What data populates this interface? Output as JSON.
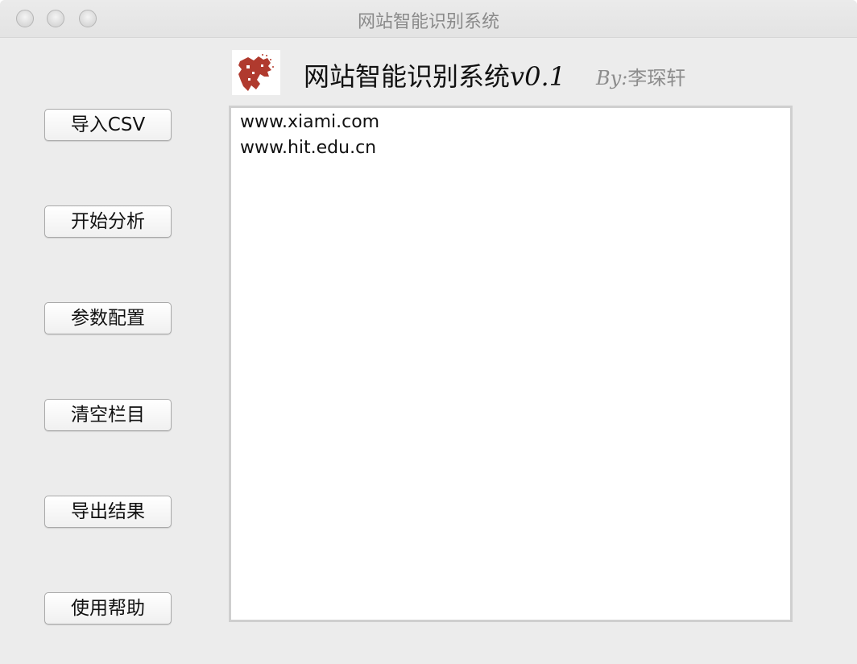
{
  "window": {
    "title": "网站智能识别系统"
  },
  "header": {
    "logo_icon": "dragon-logo-icon",
    "title": "网站智能识别系统",
    "version": "v0.1",
    "author_prefix": "By:",
    "author_name": "李琛轩"
  },
  "buttons": [
    {
      "label": "导入CSV"
    },
    {
      "label": "开始分析"
    },
    {
      "label": "参数配置"
    },
    {
      "label": "清空栏目"
    },
    {
      "label": "导出结果"
    },
    {
      "label": "使用帮助"
    }
  ],
  "url_list": {
    "items": [
      "www.xiami.com",
      "www.hit.edu.cn"
    ]
  },
  "colors": {
    "logo_red": "#b03a2e",
    "window_bg": "#ececec",
    "author_gray": "#8d8d8d"
  }
}
